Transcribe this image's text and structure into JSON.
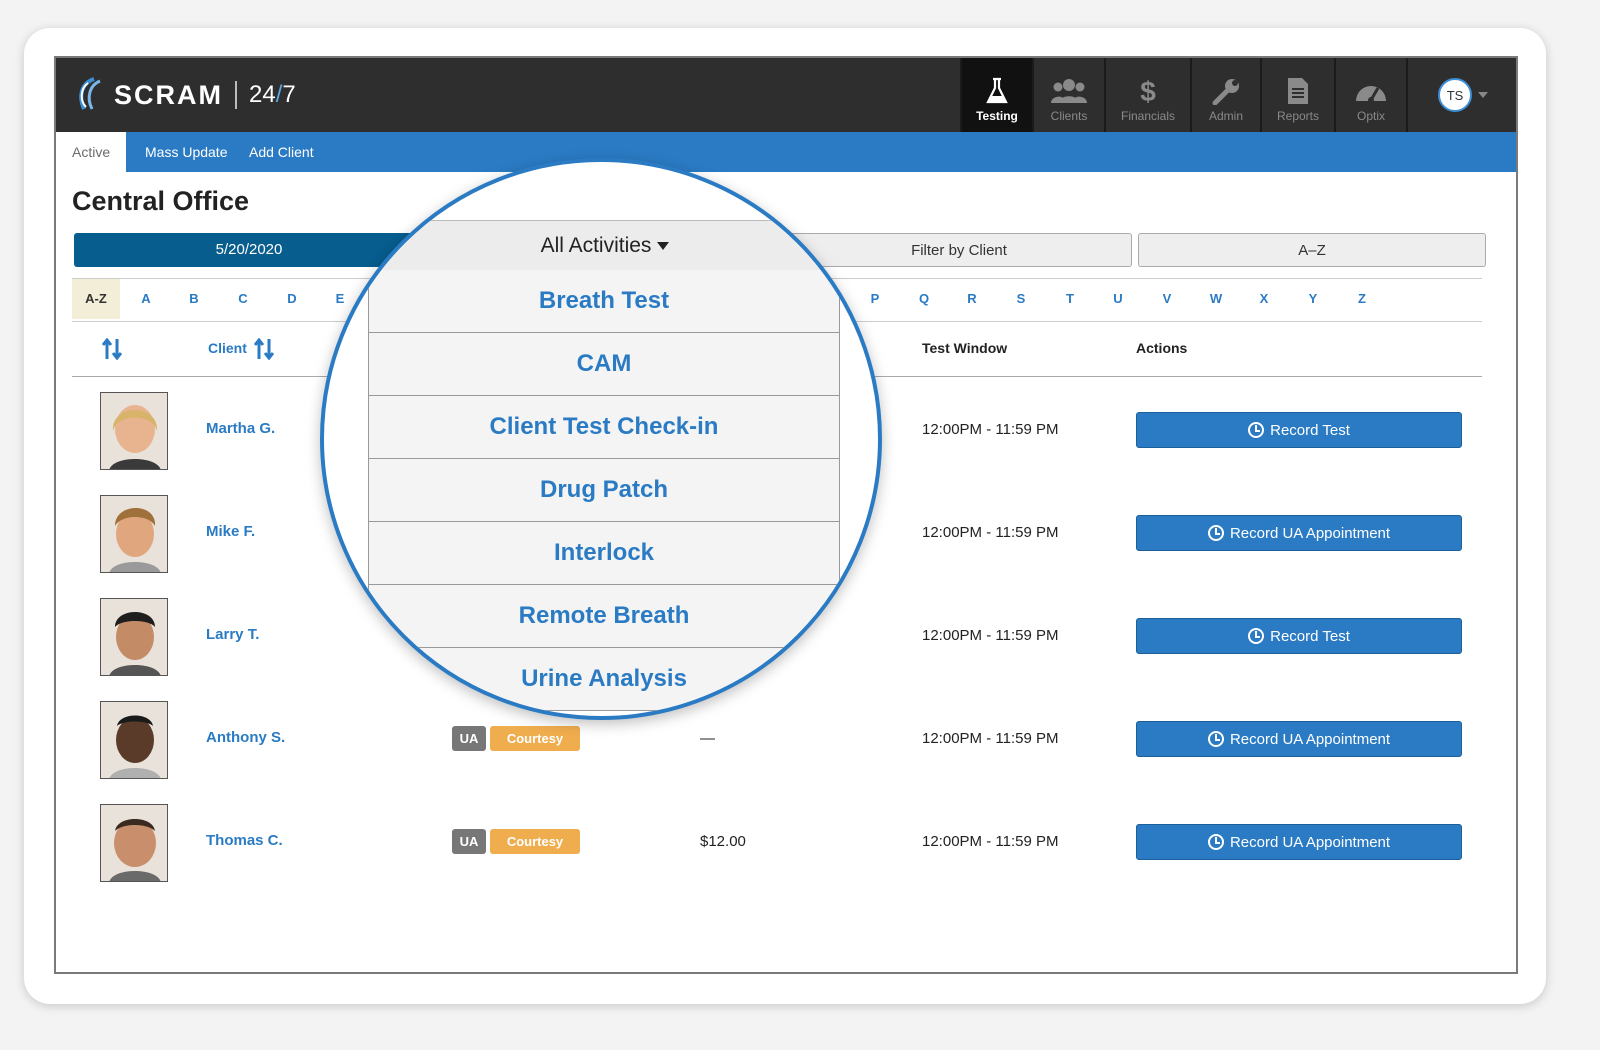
{
  "app": {
    "brand": "SCRAM",
    "brand_suffix_a": "24",
    "brand_suffix_slash": "/",
    "brand_suffix_b": "7"
  },
  "nav": [
    {
      "label": "Testing",
      "icon": "flask-icon"
    },
    {
      "label": "Clients",
      "icon": "people-icon"
    },
    {
      "label": "Financials",
      "icon": "dollar-icon"
    },
    {
      "label": "Admin",
      "icon": "wrench-icon"
    },
    {
      "label": "Reports",
      "icon": "document-icon"
    },
    {
      "label": "Optix",
      "icon": "gauge-icon"
    }
  ],
  "user": {
    "initials": "TS"
  },
  "subnav": {
    "active": "Active",
    "mass_update": "Mass Update",
    "add_client": "Add Client"
  },
  "page": {
    "title": "Central Office"
  },
  "filters": {
    "date": "5/20/2020",
    "activities": "All Activities",
    "client": "Filter by Client",
    "sort": "A–Z"
  },
  "alphabet": {
    "all": "A-Z",
    "left": [
      "A",
      "B",
      "C",
      "D",
      "E"
    ],
    "right": [
      "P",
      "Q",
      "R",
      "S",
      "T",
      "U",
      "V",
      "W",
      "X",
      "Y",
      "Z"
    ]
  },
  "table": {
    "client_col": "Client",
    "window_col": "Test Window",
    "actions_col": "Actions"
  },
  "rows": [
    {
      "name": "Martha G.",
      "window": "12:00PM - 11:59 PM",
      "action": "Record Test",
      "tag1": "",
      "tag2": "",
      "fee": ""
    },
    {
      "name": "Mike F.",
      "window": "12:00PM - 11:59 PM",
      "action": "Record UA Appointment",
      "tag1": "",
      "tag2": "",
      "fee": ""
    },
    {
      "name": "Larry T.",
      "window": "12:00PM - 11:59 PM",
      "action": "Record Test",
      "tag1": "",
      "tag2": "",
      "fee": ""
    },
    {
      "name": "Anthony S.",
      "window": "12:00PM - 11:59 PM",
      "action": "Record UA Appointment",
      "tag1": "UA",
      "tag2": "Courtesy",
      "fee": "—"
    },
    {
      "name": "Thomas C.",
      "window": "12:00PM - 11:59 PM",
      "action": "Record UA Appointment",
      "tag1": "UA",
      "tag2": "Courtesy",
      "fee": "$12.00"
    }
  ],
  "dropdown": {
    "header": "All Activities",
    "items": [
      "Breath Test",
      "CAM",
      "Client Test Check-in",
      "Drug Patch",
      "Interlock",
      "Remote Breath",
      "Urine Analysis"
    ]
  },
  "colors": {
    "accent": "#2a7bc4",
    "header": "#2e2e2e",
    "date_button": "#075d8e",
    "courtesy": "#f0ad4e"
  }
}
